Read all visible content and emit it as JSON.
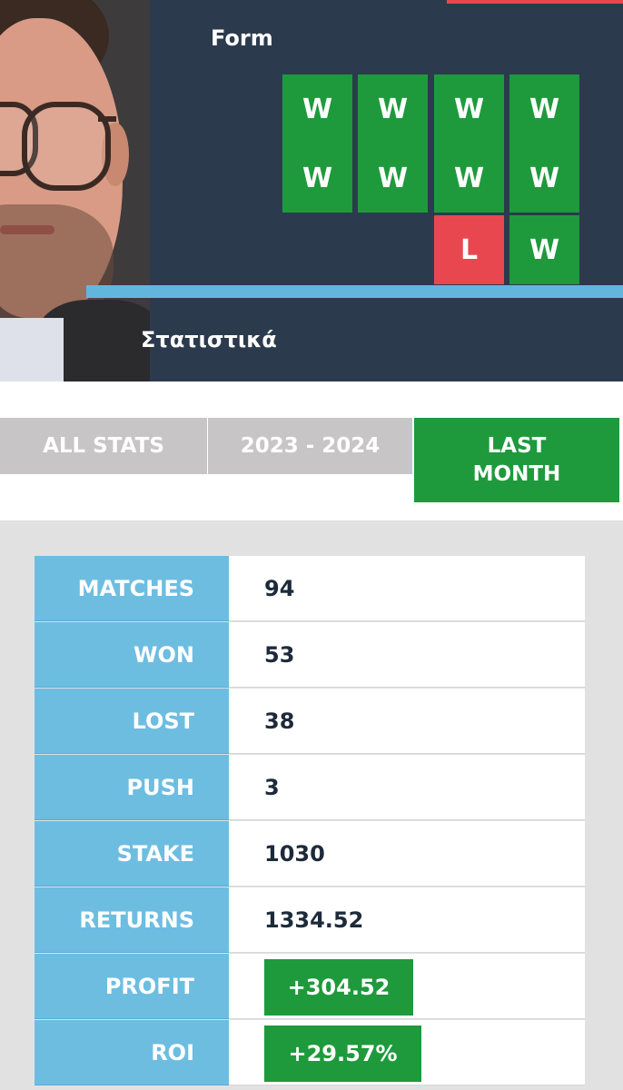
{
  "header": {
    "form_label": "Form",
    "stats_heading": "Στατιστικά",
    "form_grid": [
      [
        "W",
        "W",
        "W",
        "W"
      ],
      [
        "W",
        "W",
        "W",
        "W"
      ],
      [
        "",
        "",
        "L",
        "W"
      ]
    ]
  },
  "tabs": [
    {
      "label": "ALL STATS",
      "active": false
    },
    {
      "label": "2023 - 2024",
      "active": false
    },
    {
      "label": "LAST\nMONTH",
      "active": true
    }
  ],
  "stats": [
    {
      "label": "MATCHES",
      "value": "94"
    },
    {
      "label": "WON",
      "value": "53"
    },
    {
      "label": "LOST",
      "value": "38"
    },
    {
      "label": "PUSH",
      "value": "3"
    },
    {
      "label": "STAKE",
      "value": "1030"
    },
    {
      "label": "RETURNS",
      "value": "1334.52"
    },
    {
      "label": "PROFIT",
      "value": "+304.52",
      "badge": true
    },
    {
      "label": "ROI",
      "value": "+29.57%",
      "badge": true
    }
  ],
  "colors": {
    "win": "#1e9a3c",
    "loss": "#e8474f",
    "header_bg": "#2c3a4d",
    "label_bg": "#6dbde1",
    "accent": "#62b6de"
  }
}
